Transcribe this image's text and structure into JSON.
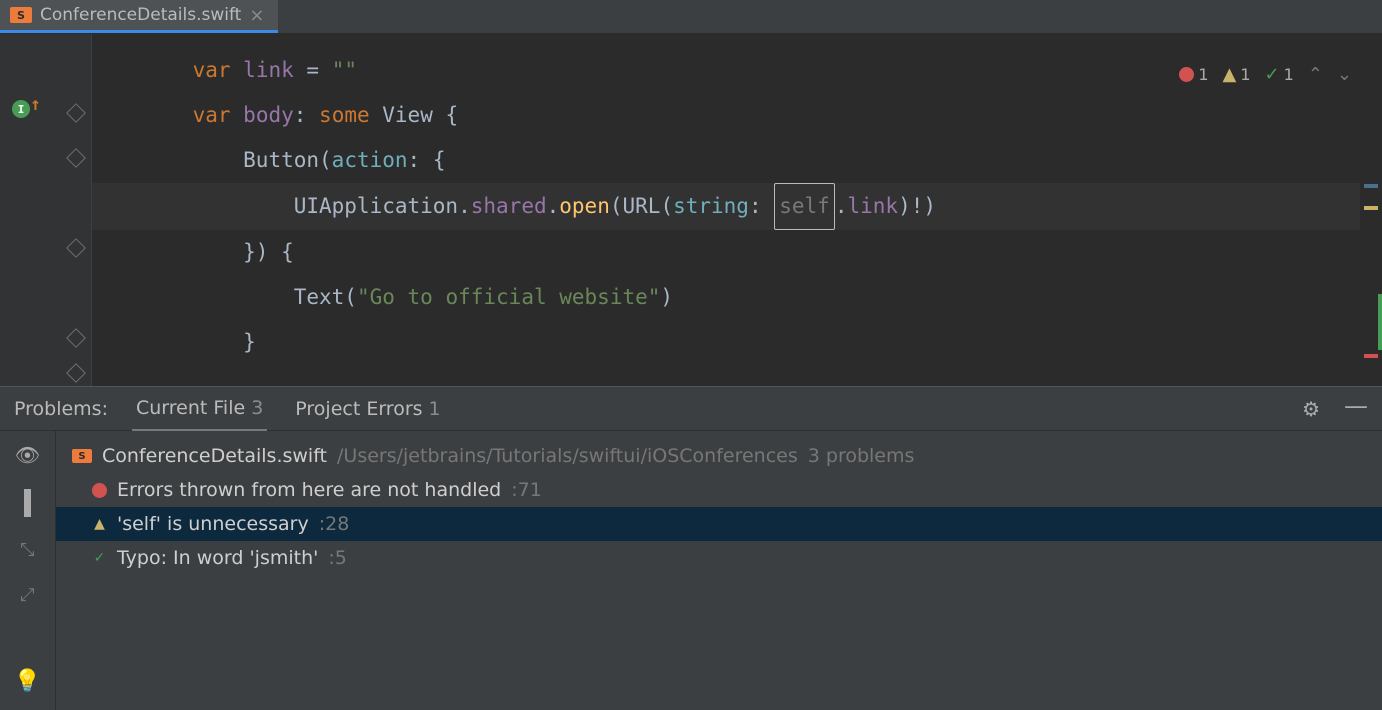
{
  "tab": {
    "filename": "ConferenceDetails.swift",
    "icon_label": "S"
  },
  "inspection": {
    "errors": "1",
    "warnings": "1",
    "typos": "1"
  },
  "code": {
    "l1_var": "var",
    "l1_name": "link",
    "l1_eq": " = ",
    "l1_str": "\"\"",
    "l2_var": "var",
    "l2_name": "body",
    "l2_colon": ": ",
    "l2_some": "some",
    "l2_view": " View",
    "l2_brace": " {",
    "l3_button": "Button",
    "l3_open": "(",
    "l3_action": "action",
    "l3_rest": ": {",
    "l4_uapp": "UIApplication",
    "l4_dot1": ".",
    "l4_shared": "shared",
    "l4_dot2": ".",
    "l4_open": "open",
    "l4_p1": "(",
    "l4_url": "URL",
    "l4_p2": "(",
    "l4_string": "string",
    "l4_colon": ": ",
    "l4_self": "self",
    "l4_dotlink": ".",
    "l4_link": "link",
    "l4_end": ")!)",
    "l5": "}) {",
    "l6_text": "Text",
    "l6_p": "(",
    "l6_str": "\"Go to official website\"",
    "l6_pc": ")",
    "l7": "}"
  },
  "problems": {
    "title": "Problems:",
    "tab_current": "Current File",
    "tab_current_count": "3",
    "tab_project": "Project Errors",
    "tab_project_count": "1",
    "file": {
      "name": "ConferenceDetails.swift",
      "path": "/Users/jetbrains/Tutorials/swiftui/iOSConferences",
      "count": "3 problems"
    },
    "items": [
      {
        "text": "Errors thrown from here are not handled",
        "loc": ":71"
      },
      {
        "text": "'self' is unnecessary",
        "loc": ":28"
      },
      {
        "text": "Typo: In word 'jsmith'",
        "loc": ":5"
      }
    ]
  }
}
